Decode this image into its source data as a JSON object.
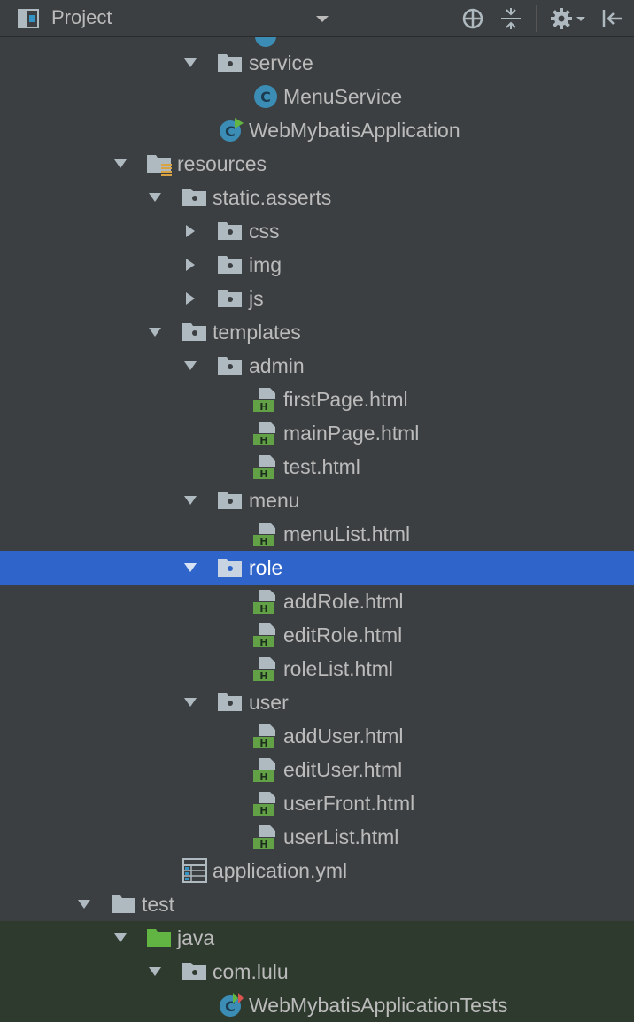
{
  "toolbar": {
    "title": "Project",
    "icons": [
      "project-view-icon",
      "dropdown-icon",
      "locate-icon",
      "collapse-all-icon",
      "settings-icon",
      "hide-panel-icon"
    ]
  },
  "tree": {
    "rows": [
      {
        "label": "service",
        "icon": "package-folder-icon"
      },
      {
        "label": "MenuService",
        "icon": "java-class-icon"
      },
      {
        "label": "WebMybatisApplication",
        "icon": "spring-boot-class-icon"
      },
      {
        "label": "resources",
        "icon": "resources-folder-icon"
      },
      {
        "label": "static.asserts",
        "icon": "package-folder-icon"
      },
      {
        "label": "css",
        "icon": "package-folder-icon"
      },
      {
        "label": "img",
        "icon": "package-folder-icon"
      },
      {
        "label": "js",
        "icon": "package-folder-icon"
      },
      {
        "label": "templates",
        "icon": "package-folder-icon"
      },
      {
        "label": "admin",
        "icon": "package-folder-icon"
      },
      {
        "label": "firstPage.html",
        "icon": "html-file-icon"
      },
      {
        "label": "mainPage.html",
        "icon": "html-file-icon"
      },
      {
        "label": "test.html",
        "icon": "html-file-icon"
      },
      {
        "label": "menu",
        "icon": "package-folder-icon"
      },
      {
        "label": "menuList.html",
        "icon": "html-file-icon"
      },
      {
        "label": "role",
        "icon": "package-folder-icon",
        "selected": true
      },
      {
        "label": "addRole.html",
        "icon": "html-file-icon"
      },
      {
        "label": "editRole.html",
        "icon": "html-file-icon"
      },
      {
        "label": "roleList.html",
        "icon": "html-file-icon"
      },
      {
        "label": "user",
        "icon": "package-folder-icon"
      },
      {
        "label": "addUser.html",
        "icon": "html-file-icon"
      },
      {
        "label": "editUser.html",
        "icon": "html-file-icon"
      },
      {
        "label": "userFront.html",
        "icon": "html-file-icon"
      },
      {
        "label": "userList.html",
        "icon": "html-file-icon"
      },
      {
        "label": "application.yml",
        "icon": "yaml-file-icon"
      },
      {
        "label": "test",
        "icon": "folder-icon"
      },
      {
        "label": "java",
        "icon": "test-source-folder-icon"
      },
      {
        "label": "com.lulu",
        "icon": "package-folder-icon"
      },
      {
        "label": "WebMybatisApplicationTests",
        "icon": "spring-boot-test-class-icon"
      }
    ]
  },
  "colors": {
    "background": "#3c3f41",
    "selection": "#2f65ca",
    "text": "#bbbbbb",
    "test_source_background": "#2f3a2f",
    "html_icon_green": "#62a145",
    "class_icon_teal": "#3b8db5"
  }
}
